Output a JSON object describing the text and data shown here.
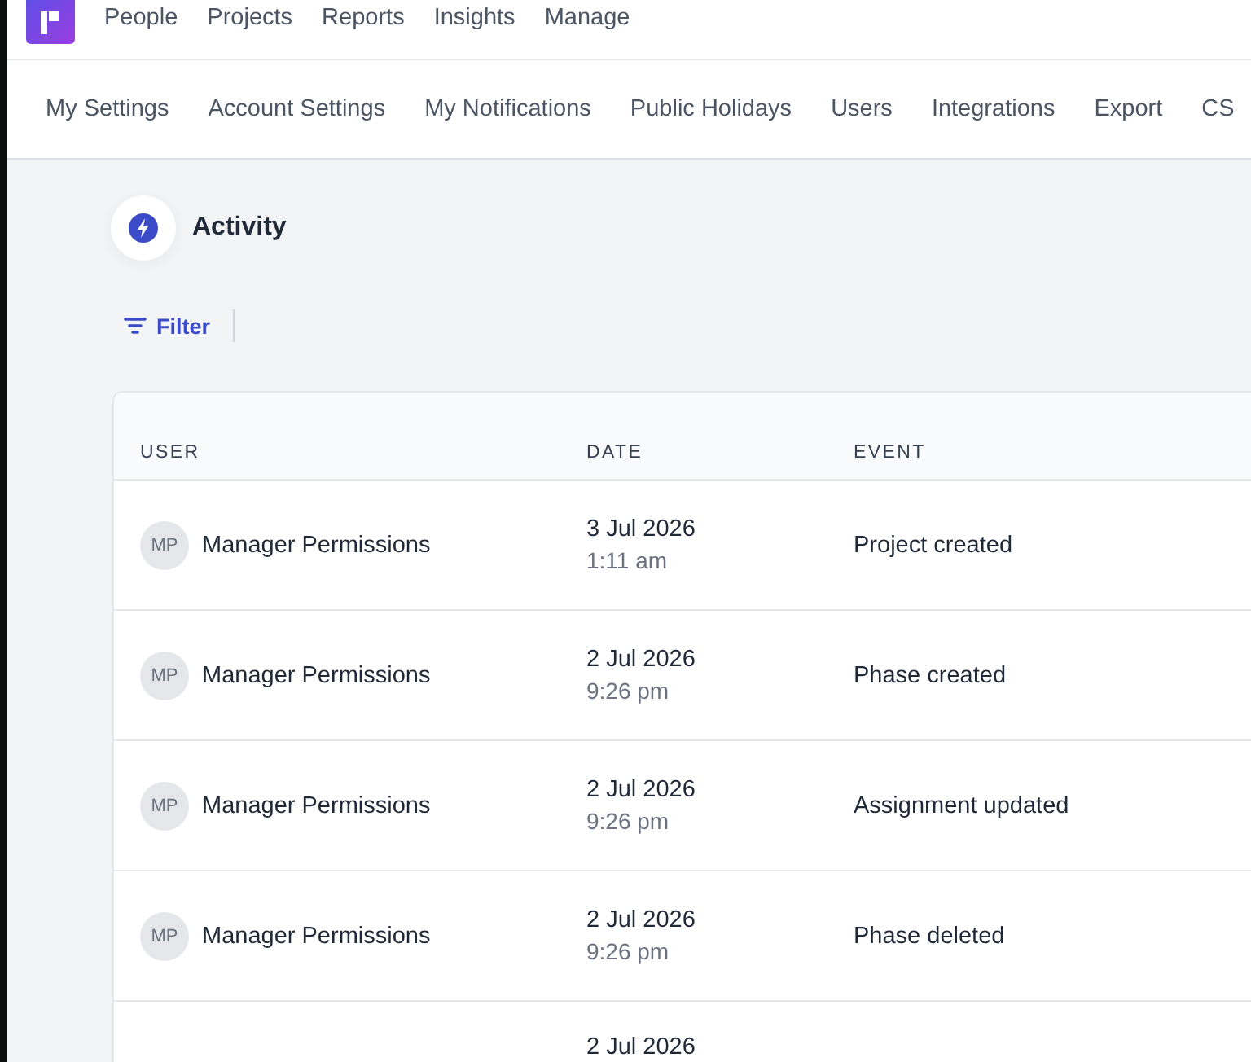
{
  "top_nav": {
    "items": [
      "People",
      "Projects",
      "Reports",
      "Insights",
      "Manage"
    ]
  },
  "settings_nav": {
    "items": [
      "My Settings",
      "Account Settings",
      "My Notifications",
      "Public Holidays",
      "Users",
      "Integrations",
      "Export",
      "CS"
    ]
  },
  "page": {
    "title": "Activity",
    "filter_label": "Filter"
  },
  "table": {
    "columns": [
      "USER",
      "DATE",
      "EVENT"
    ],
    "rows": [
      {
        "initials": "MP",
        "user": "Manager Permissions",
        "date": "3 Jul 2026",
        "time": "1:11 am",
        "event": "Project created"
      },
      {
        "initials": "MP",
        "user": "Manager Permissions",
        "date": "2 Jul 2026",
        "time": "9:26 pm",
        "event": "Phase created"
      },
      {
        "initials": "MP",
        "user": "Manager Permissions",
        "date": "2 Jul 2026",
        "time": "9:26 pm",
        "event": "Assignment updated"
      },
      {
        "initials": "MP",
        "user": "Manager Permissions",
        "date": "2 Jul 2026",
        "time": "9:26 pm",
        "event": "Phase deleted"
      },
      {
        "date": "2 Jul 2026"
      }
    ]
  }
}
